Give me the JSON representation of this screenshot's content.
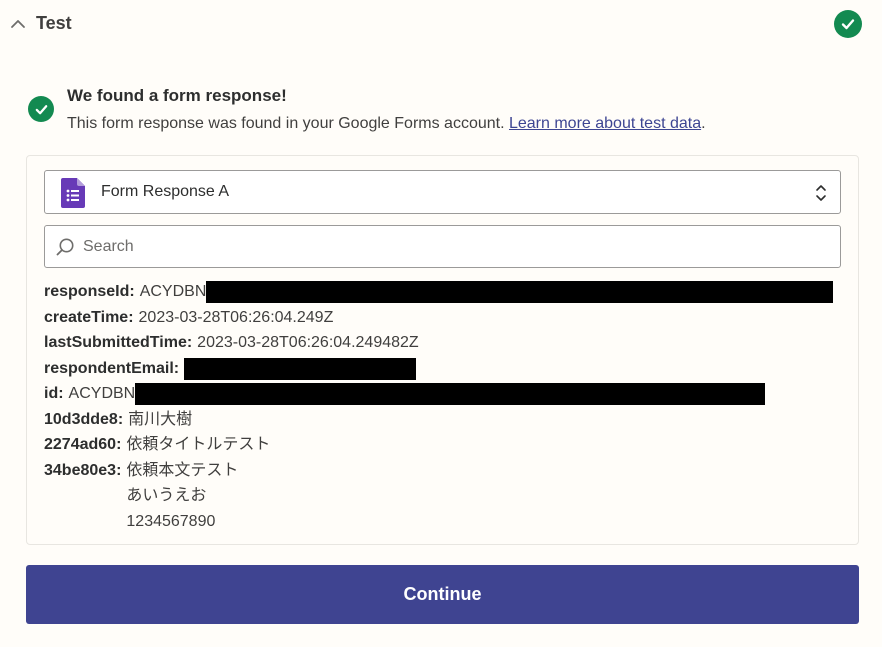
{
  "header": {
    "title": "Test",
    "status_icon": "check-circle-icon",
    "collapse_icon": "chevron-up-icon"
  },
  "notice": {
    "icon": "check-circle-icon",
    "title": "We found a form response!",
    "text": "This form response was found in your Google Forms account. ",
    "link": "Learn more about test data",
    "after_link": "."
  },
  "selector": {
    "icon": "google-forms-icon",
    "value": "Form Response A",
    "toggle_icon": "chevron-up-down-icon"
  },
  "search": {
    "placeholder": "Search",
    "value": ""
  },
  "fields": [
    {
      "key": "responseId:",
      "value": "ACYDBN",
      "redacted": true
    },
    {
      "key": "createTime:",
      "value": "2023-03-28T06:26:04.249Z"
    },
    {
      "key": "lastSubmittedTime:",
      "value": "2023-03-28T06:26:04.249482Z"
    },
    {
      "key": "respondentEmail:",
      "value": "",
      "redacted": true
    },
    {
      "key": "id:",
      "value": "ACYDBN",
      "redacted": true
    },
    {
      "key": "10d3dde8:",
      "value": "南川大樹"
    },
    {
      "key": "2274ad60:",
      "value": "依頼タイトルテスト"
    },
    {
      "key": "34be80e3:",
      "lines": [
        "依頼本文テスト",
        "あいうえお",
        "1234567890"
      ]
    }
  ],
  "continue_label": "Continue",
  "colors": {
    "accent": "#3f4491",
    "success": "#138a51",
    "link": "#3d4592",
    "forms_purple": "#673ab7",
    "background": "#fffdf9"
  }
}
